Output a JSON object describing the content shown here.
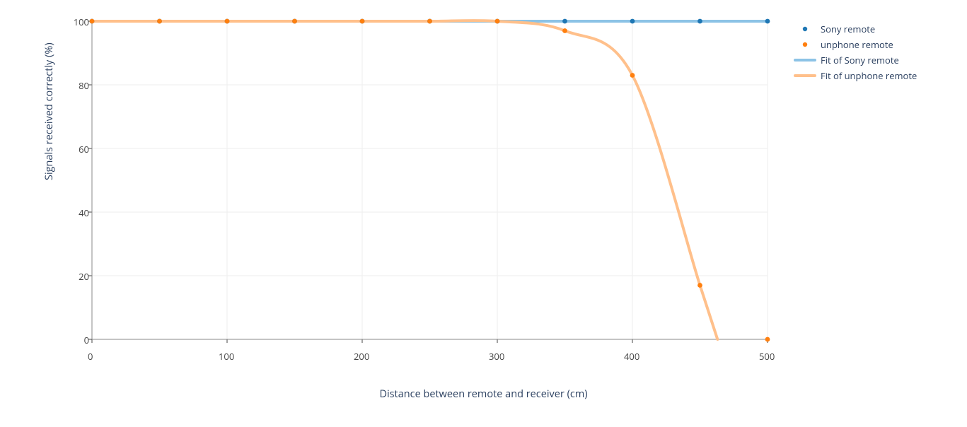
{
  "chart_data": {
    "type": "scatter",
    "title": "",
    "xlabel": "Distance between remote and receiver (cm)",
    "ylabel": "Signals received correctly (%)",
    "xlim": [
      0,
      500
    ],
    "ylim": [
      0,
      100
    ],
    "xticks": [
      0,
      100,
      200,
      300,
      400,
      500
    ],
    "yticks": [
      0,
      20,
      40,
      60,
      80,
      100
    ],
    "x": [
      0,
      50,
      100,
      150,
      200,
      250,
      300,
      350,
      400,
      450,
      500
    ],
    "series": [
      {
        "name": "Sony remote",
        "type": "scatter",
        "color": "#1f77b4",
        "values": [
          100,
          100,
          100,
          100,
          100,
          100,
          100,
          100,
          100,
          100,
          100
        ]
      },
      {
        "name": "unphone remote",
        "type": "scatter",
        "color": "#ff7f0e",
        "values": [
          100,
          100,
          100,
          100,
          100,
          100,
          100,
          97,
          83,
          17,
          0
        ]
      },
      {
        "name": "Fit of Sony remote",
        "type": "line",
        "color": "#8cc3e6",
        "thickness": 4,
        "values": [
          100,
          100,
          100,
          100,
          100,
          100,
          100,
          100,
          100,
          100,
          100
        ]
      },
      {
        "name": "Fit of unphone remote",
        "type": "line",
        "color": "#ffc08b",
        "thickness": 4,
        "values": [
          100,
          100,
          100,
          100,
          100,
          100,
          100,
          97,
          83,
          17,
          0
        ]
      }
    ],
    "legend_position": "right",
    "grid": true
  },
  "legend": {
    "items": [
      "Sony remote",
      "unphone remote",
      "Fit of Sony remote",
      "Fit of unphone remote"
    ]
  },
  "axes": {
    "x_label": "Distance between remote and receiver (cm)",
    "y_label": "Signals received correctly (%)",
    "x_ticks": [
      "0",
      "100",
      "200",
      "300",
      "400",
      "500"
    ],
    "y_ticks": [
      "0",
      "20",
      "40",
      "60",
      "80",
      "100"
    ]
  },
  "colors": {
    "sony_marker": "#1f77b4",
    "unphone_marker": "#ff7f0e",
    "sony_fit": "#8cc3e6",
    "unphone_fit": "#ffc08b",
    "grid": "#eeeeee",
    "zeroline": "#888888",
    "tick": "#444444"
  }
}
